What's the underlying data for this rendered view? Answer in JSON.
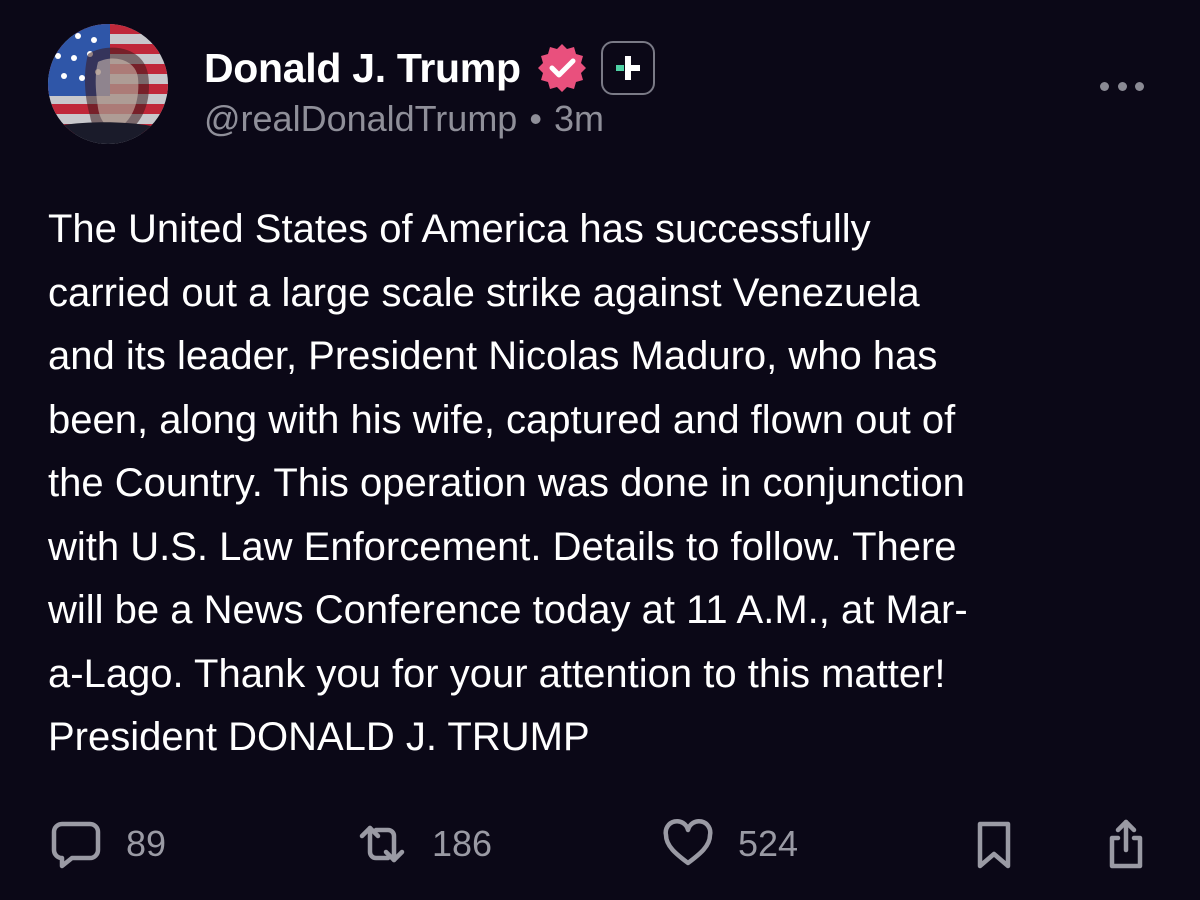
{
  "post": {
    "author": {
      "display_name": "Donald J. Trump",
      "handle": "@realDonaldTrump",
      "verified_badge": "verified-check-icon",
      "plus_badge": "plus-badge-icon",
      "avatar": "avatar-american-flag-portrait"
    },
    "separator": "•",
    "timestamp": "3m",
    "more_icon": "more-dots-icon",
    "body_lines": [
      "The United States of America has successfully",
      "carried out a large scale strike against Venezuela",
      "and its leader, President Nicolas Maduro, who has",
      "been, along with his wife, captured and flown out of",
      "the Country. This operation was done in conjunction",
      "with U.S. Law Enforcement. Details to follow. There",
      "will be a News Conference today at 11 A.M., at Mar-",
      "a-Lago. Thank you for your attention to this matter!",
      "President DONALD J. TRUMP"
    ],
    "actions": {
      "reply": {
        "icon": "reply-bubble-icon",
        "count": "89"
      },
      "repost": {
        "icon": "repost-arrows-icon",
        "count": "186"
      },
      "like": {
        "icon": "heart-icon",
        "count": "524"
      },
      "bookmark": {
        "icon": "bookmark-icon"
      },
      "share": {
        "icon": "share-icon"
      }
    }
  },
  "colors": {
    "background": "#0b0817",
    "primary_text": "#ffffff",
    "secondary_text": "#8f8f99",
    "verified_pink": "#e9507d",
    "plus_green": "#4fd1a5"
  }
}
